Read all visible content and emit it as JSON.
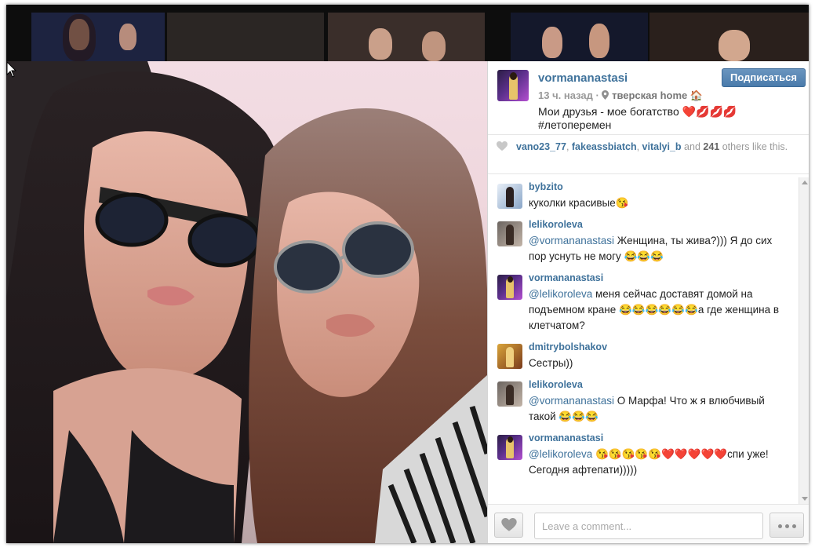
{
  "post": {
    "username": "vormananastasi",
    "follow_label": "Подписаться",
    "time": "13 ч. назад",
    "separator": "·",
    "location_icon": "map-pin-icon",
    "location": "тверская home 🏠",
    "caption": "Мои друзья - мое богатство ❤️💋💋💋#летоперемен"
  },
  "likes": {
    "users": [
      "vano23_77",
      "fakeassbiatch",
      "vitalyi_b"
    ],
    "and_text": "and",
    "count": "241",
    "suffix": "others like this."
  },
  "comments": [
    {
      "user": "bybzito",
      "mention": "",
      "text": "куколки красивые😘"
    },
    {
      "user": "lelikoroleva",
      "mention": "@vormananastasi",
      "text": " Женщина, ты жива?))) Я до сих пор уснуть не могу 😂😂😂"
    },
    {
      "user": "vormananastasi",
      "mention": "@lelikoroleva",
      "text": " меня сейчас доставят домой на подъемном кране 😂😂😂😂😂😂а где женщина в клетчатом?"
    },
    {
      "user": "dmitrybolshakov",
      "mention": "",
      "text": "Сестры))"
    },
    {
      "user": "lelikoroleva",
      "mention": "@vormananastasi",
      "text": " О Марфа! Что ж я влюбчивый такой 😂😂😂"
    },
    {
      "user": "vormananastasi",
      "mention": "@lelikoroleva",
      "text": " 😘😘😘😘😘❤️❤️❤️❤️❤️спи уже! Сегодня афтепати)))))"
    }
  ],
  "footer": {
    "comment_placeholder": "Leave a comment...",
    "like_icon": "heart-icon",
    "more_icon": "more-options-icon"
  },
  "colors": {
    "link": "#3f729b",
    "follow_button": "#4a7bab"
  }
}
